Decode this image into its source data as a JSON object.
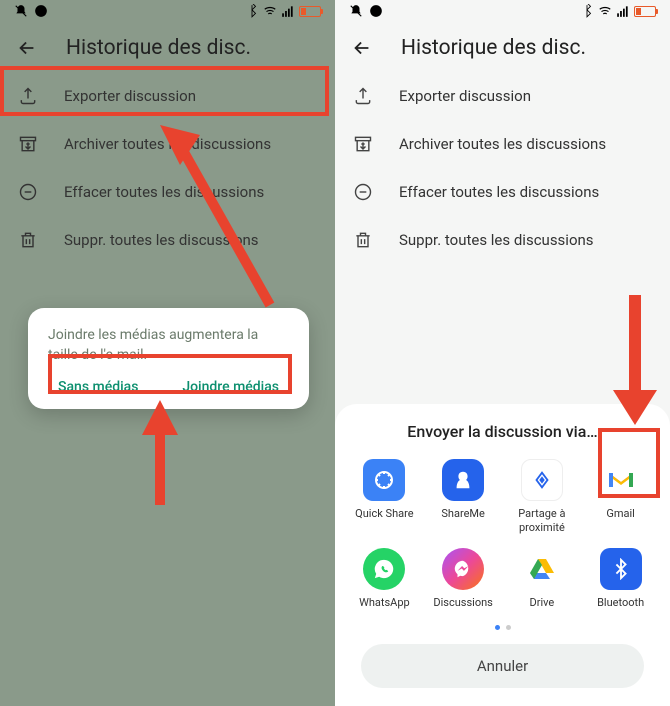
{
  "header": {
    "title": "Historique des disc."
  },
  "menu": {
    "export": "Exporter discussion",
    "archive": "Archiver toutes les discussions",
    "clear": "Effacer toutes les discussions",
    "delete": "Suppr. toutes les discussions"
  },
  "dialog": {
    "message": "Joindre les médias augmentera la taille de l'e-mail.",
    "noMedia": "Sans médias",
    "withMedia": "Joindre médias"
  },
  "share": {
    "title": "Envoyer la discussion via…",
    "apps": [
      {
        "name": "Quick Share"
      },
      {
        "name": "ShareMe"
      },
      {
        "name": "Partage à proximité"
      },
      {
        "name": "Gmail"
      },
      {
        "name": "WhatsApp"
      },
      {
        "name": "Discussions"
      },
      {
        "name": "Drive"
      },
      {
        "name": "Bluetooth"
      }
    ],
    "cancel": "Annuler"
  }
}
